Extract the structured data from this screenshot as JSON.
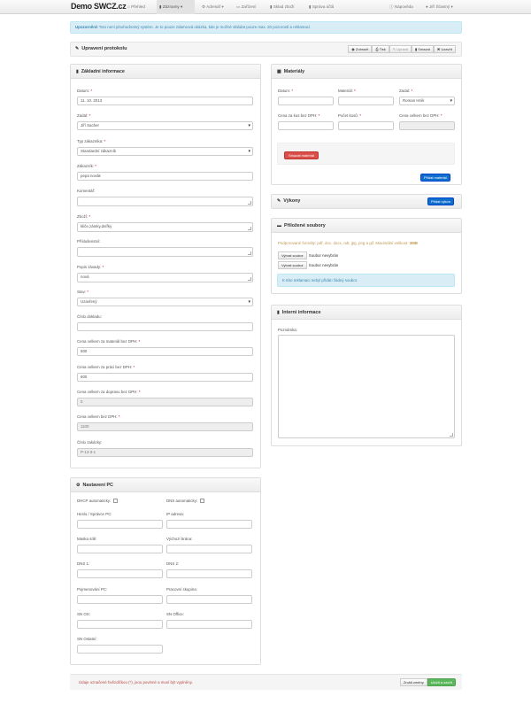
{
  "nav": {
    "brand": "Demo SWCZ.cz",
    "items": [
      {
        "icon": "⌂",
        "label": "Přehled"
      },
      {
        "icon": "▮",
        "label": "Záznamy ▾"
      },
      {
        "icon": "⚙",
        "label": "Adresář ▾"
      },
      {
        "icon": "▭",
        "label": "Zařízení"
      },
      {
        "icon": "▮",
        "label": "Sklad zboží"
      },
      {
        "icon": "▮",
        "label": "Správa účtů"
      }
    ],
    "help": "Nápověda",
    "user": "Jiří Šťastný ▾"
  },
  "alert": {
    "strong": "Upozornění!",
    "text": " Toto není plnohodnotný systém. Je to pouze zdarmová ukázka, kde je možné vkládat pouze max. 20 pozorostí a reklamací."
  },
  "header": {
    "title": "Upravení protokolu",
    "buttons": [
      "Zobrazit",
      "Tisk",
      "Upravit",
      "Smazat",
      "Uzavřít"
    ]
  },
  "basic": {
    "title": "Základní informace",
    "datum_label": "Datum:",
    "datum": "11. 10. 2013",
    "zadal_label": "Zadal:",
    "zadal": "Jiří Sacher",
    "typ_label": "Typ zákazníka:",
    "typ": "Standardní zákazník",
    "zakaznik_label": "Zákazník:",
    "zakaznik": "pepa novák",
    "komentar_label": "Komentář:",
    "zbozi_label": "Zboží:",
    "zbozi": "kliče,zámky,dvířky",
    "prislusenstvi_label": "Příslušenství:",
    "popis_label": "Popis závady:",
    "popis": "nová",
    "stav_label": "Stav:",
    "stav": "Uzavřený",
    "cislo_dokladu_label": "Číslo dokladu:",
    "cena_material_label": "Cena celkem za materiál bez DPH:",
    "cena_material": "500",
    "cena_prace_label": "Cena celkem za práci bez DPH:",
    "cena_prace": "600",
    "cena_doprava_label": "Cena celkem za dopravu bez DPH:",
    "cena_doprava": "0",
    "cena_celkem_label": "Cena celkem bez DPH:",
    "cena_celkem": "1100",
    "cislo_zakazky_label": "Číslo zakázky:",
    "cislo_zakazky": "P-13-3-1"
  },
  "materialy": {
    "title": "Materiály",
    "datum_label": "Datum:",
    "material_label": "Materiál:",
    "zadal_label": "Zadal:",
    "zadal": "Roman Hník",
    "cena_label": "Cena za kus bez DPH:",
    "pocet_label": "Počet kusů:",
    "celkem_label": "Cena celkem bez DPH:",
    "delete_btn": "Smazat materiál",
    "add_btn": "Přidat materiál"
  },
  "vykony": {
    "title": "Výkony",
    "add_btn": "Přidat výkon"
  },
  "soubory": {
    "title": "Přiložené soubory",
    "supported": "Podporované formáty: pdf, doc, docx, odt, jpg, png a gif. Maximální velikost: ",
    "max": "3MB",
    "choose": "Vybrat soubor",
    "none": "Soubor nevybrán",
    "info": "K této reklamaci nebyl přidán žádný soubor."
  },
  "interni": {
    "title": "Interní informace",
    "poznamka_label": "Poznámka:"
  },
  "pc": {
    "title": "Nastavení PC",
    "dhcp": "DHCP automaticky:",
    "dns_auto": "DNS automaticky:",
    "heslo": "Heslo / Správce PC:",
    "ip": "IP adresa:",
    "maska": "Maska sítě:",
    "brana": "Výchozí brána:",
    "dns1": "DNS 1:",
    "dns2": "DNS 2:",
    "pojmenovani": "Pojmenování PC:",
    "skupina": "Pracovní skupina:",
    "snos": "SN OS:",
    "snoffice": "SN Office:",
    "snostatni": "SN Ostatní:"
  },
  "footer": {
    "note": "Údaje označené hvězdičkou (*), jsou povinné a musí být vyplněny.",
    "cancel": "Zrušit změny",
    "save": "Uložit a zavřít"
  }
}
